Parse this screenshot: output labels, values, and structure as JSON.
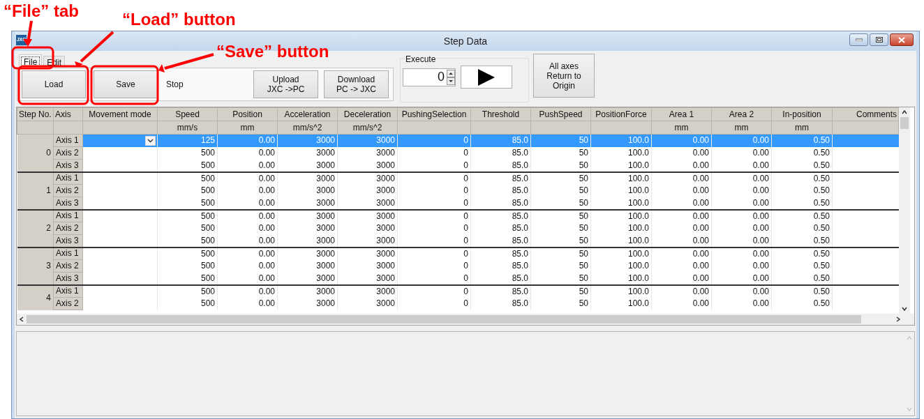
{
  "annotations": [
    {
      "label": "“File” tab"
    },
    {
      "label": "“Load” button"
    },
    {
      "label": "“Save” button"
    }
  ],
  "window": {
    "icon_text": "JXC",
    "title": "Step Data"
  },
  "tabs": [
    {
      "label": "File",
      "selected": true
    },
    {
      "label": "Edit",
      "selected": false
    }
  ],
  "file_panel": {
    "buttons": [
      {
        "label": "Load"
      },
      {
        "label": "Save"
      }
    ],
    "status": "Stop",
    "transfer_buttons": [
      {
        "label": "Upload\nJXC ->PC"
      },
      {
        "label": "Download\nPC -> JXC"
      }
    ]
  },
  "execute": {
    "legend": "Execute",
    "value": "0"
  },
  "origin_button": {
    "label": "All axes\nReturn to\nOrigin"
  },
  "table": {
    "columns": [
      {
        "label": "Step No."
      },
      {
        "label": "Axis"
      },
      {
        "label": "Movement mode"
      },
      {
        "label": "Speed",
        "unit": "mm/s"
      },
      {
        "label": "Position",
        "unit": "mm"
      },
      {
        "label": "Acceleration",
        "unit": "mm/s^2"
      },
      {
        "label": "Deceleration",
        "unit": "mm/s^2"
      },
      {
        "label": "PushingSelection"
      },
      {
        "label": "Threshold"
      },
      {
        "label": "PushSpeed"
      },
      {
        "label": "PositionForce"
      },
      {
        "label": "Area 1",
        "unit": "mm"
      },
      {
        "label": "Area 2",
        "unit": "mm"
      },
      {
        "label": "In-position",
        "unit": "mm"
      },
      {
        "label": "Comments"
      }
    ],
    "steps": [
      {
        "step": "0",
        "rows": [
          {
            "axis": "Axis 1",
            "selected": true,
            "values": [
              "125",
              "0.00",
              "3000",
              "3000",
              "0",
              "85.0",
              "50",
              "100.0",
              "0.00",
              "0.00",
              "0.50"
            ]
          },
          {
            "axis": "Axis 2",
            "selected": false,
            "values": [
              "500",
              "0.00",
              "3000",
              "3000",
              "0",
              "85.0",
              "50",
              "100.0",
              "0.00",
              "0.00",
              "0.50"
            ]
          },
          {
            "axis": "Axis 3",
            "selected": false,
            "values": [
              "500",
              "0.00",
              "3000",
              "3000",
              "0",
              "85.0",
              "50",
              "100.0",
              "0.00",
              "0.00",
              "0.50"
            ]
          }
        ]
      },
      {
        "step": "1",
        "rows": [
          {
            "axis": "Axis 1",
            "selected": false,
            "values": [
              "500",
              "0.00",
              "3000",
              "3000",
              "0",
              "85.0",
              "50",
              "100.0",
              "0.00",
              "0.00",
              "0.50"
            ]
          },
          {
            "axis": "Axis 2",
            "selected": false,
            "values": [
              "500",
              "0.00",
              "3000",
              "3000",
              "0",
              "85.0",
              "50",
              "100.0",
              "0.00",
              "0.00",
              "0.50"
            ]
          },
          {
            "axis": "Axis 3",
            "selected": false,
            "values": [
              "500",
              "0.00",
              "3000",
              "3000",
              "0",
              "85.0",
              "50",
              "100.0",
              "0.00",
              "0.00",
              "0.50"
            ]
          }
        ]
      },
      {
        "step": "2",
        "rows": [
          {
            "axis": "Axis 1",
            "selected": false,
            "values": [
              "500",
              "0.00",
              "3000",
              "3000",
              "0",
              "85.0",
              "50",
              "100.0",
              "0.00",
              "0.00",
              "0.50"
            ]
          },
          {
            "axis": "Axis 2",
            "selected": false,
            "values": [
              "500",
              "0.00",
              "3000",
              "3000",
              "0",
              "85.0",
              "50",
              "100.0",
              "0.00",
              "0.00",
              "0.50"
            ]
          },
          {
            "axis": "Axis 3",
            "selected": false,
            "values": [
              "500",
              "0.00",
              "3000",
              "3000",
              "0",
              "85.0",
              "50",
              "100.0",
              "0.00",
              "0.00",
              "0.50"
            ]
          }
        ]
      },
      {
        "step": "3",
        "rows": [
          {
            "axis": "Axis 1",
            "selected": false,
            "values": [
              "500",
              "0.00",
              "3000",
              "3000",
              "0",
              "85.0",
              "50",
              "100.0",
              "0.00",
              "0.00",
              "0.50"
            ]
          },
          {
            "axis": "Axis 2",
            "selected": false,
            "values": [
              "500",
              "0.00",
              "3000",
              "3000",
              "0",
              "85.0",
              "50",
              "100.0",
              "0.00",
              "0.00",
              "0.50"
            ]
          },
          {
            "axis": "Axis 3",
            "selected": false,
            "values": [
              "500",
              "0.00",
              "3000",
              "3000",
              "0",
              "85.0",
              "50",
              "100.0",
              "0.00",
              "0.00",
              "0.50"
            ]
          }
        ]
      },
      {
        "step": "4",
        "rows": [
          {
            "axis": "Axis 1",
            "selected": false,
            "values": [
              "500",
              "0.00",
              "3000",
              "3000",
              "0",
              "85.0",
              "50",
              "100.0",
              "0.00",
              "0.00",
              "0.50"
            ]
          },
          {
            "axis": "Axis 2",
            "selected": false,
            "values": [
              "500",
              "0.00",
              "3000",
              "3000",
              "0",
              "85.0",
              "50",
              "100.0",
              "0.00",
              "0.00",
              "0.50"
            ]
          }
        ]
      }
    ]
  }
}
